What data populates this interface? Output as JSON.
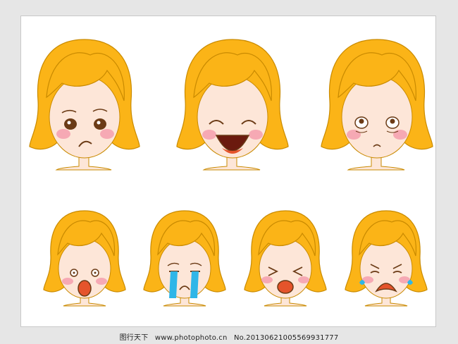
{
  "palette": {
    "hair": "#fbb417",
    "hair_outline": "#c98a00",
    "skin": "#fde6d8",
    "cheek": "#f6a9b4",
    "tear": "#2fb6e8",
    "mouth": "#e5542b"
  },
  "faces": [
    {
      "expression": "sad"
    },
    {
      "expression": "laughing"
    },
    {
      "expression": "dazed"
    },
    {
      "expression": "shocked"
    },
    {
      "expression": "crying"
    },
    {
      "expression": "giggling"
    },
    {
      "expression": "sobbing"
    }
  ],
  "footer": {
    "site_name": "图行天下",
    "site_url": "www.photophoto.cn",
    "image_no": "No.20130621005569931777"
  }
}
